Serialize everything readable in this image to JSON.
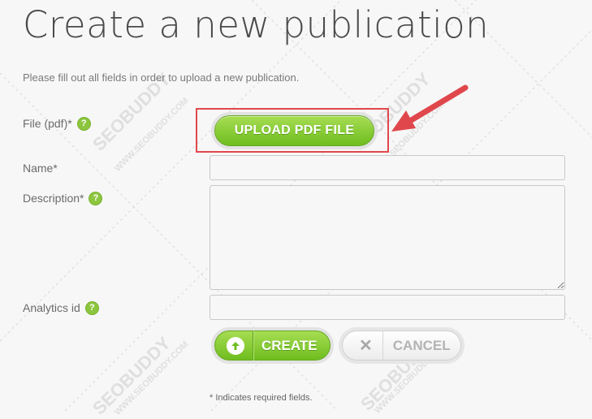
{
  "page": {
    "title": "Create a new publication",
    "intro": "Please fill out all fields in order to upload a new publication."
  },
  "form": {
    "file_label": "File (pdf)*",
    "upload_label": "UPLOAD PDF FILE",
    "name_label": "Name*",
    "name_value": "",
    "description_label": "Description*",
    "description_value": "",
    "analytics_label": "Analytics id",
    "analytics_value": "",
    "help_glyph": "?"
  },
  "actions": {
    "create_label": "CREATE",
    "cancel_label": "CANCEL"
  },
  "footer": {
    "required_note": "* Indicates required fields."
  },
  "watermark": {
    "brand": "SEOBUDDY",
    "url": "WWW.SEOBUDDY.COM"
  },
  "annotation": {
    "highlight_color": "#e0474c"
  },
  "colors": {
    "accent_green": "#8cc63f",
    "background": "#f7f7f7"
  }
}
